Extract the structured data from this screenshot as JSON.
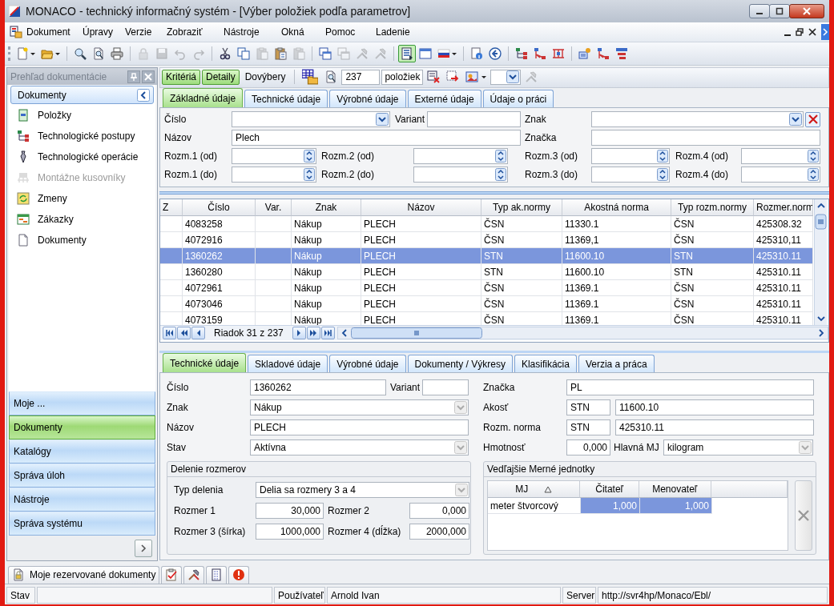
{
  "window": {
    "title": "MONACO - technický informačný systém - [Výber položiek podľa parametrov]"
  },
  "menu": [
    "Dokument",
    "Úpravy",
    "Verzie",
    "Zobraziť",
    "Nástroje",
    "Okná",
    "Pomoc",
    "Ladenie"
  ],
  "toolbar": [
    [
      {
        "kind": "new",
        "disabled": false,
        "pressed": false,
        "dropdown": true
      },
      {
        "kind": "open",
        "disabled": false,
        "pressed": false,
        "dropdown": true
      }
    ],
    [
      {
        "kind": "search",
        "disabled": false,
        "pressed": false,
        "dropdown": false
      },
      {
        "kind": "preview",
        "disabled": false,
        "pressed": false,
        "dropdown": false
      },
      {
        "kind": "print",
        "disabled": false,
        "pressed": false,
        "dropdown": false
      }
    ],
    [
      {
        "kind": "lock",
        "disabled": true,
        "pressed": false,
        "dropdown": false
      },
      {
        "kind": "save",
        "disabled": true,
        "pressed": false,
        "dropdown": false
      },
      {
        "kind": "undo",
        "disabled": true,
        "pressed": false,
        "dropdown": false
      },
      {
        "kind": "redo",
        "disabled": true,
        "pressed": false,
        "dropdown": false
      }
    ],
    [
      {
        "kind": "cut",
        "disabled": false,
        "pressed": false,
        "dropdown": false
      },
      {
        "kind": "copy",
        "disabled": false,
        "pressed": false,
        "dropdown": false
      },
      {
        "kind": "paste",
        "disabled": true,
        "pressed": false,
        "dropdown": false
      },
      {
        "kind": "paste_special",
        "disabled": false,
        "pressed": false,
        "dropdown": false
      },
      {
        "kind": "paste",
        "disabled": true,
        "pressed": false,
        "dropdown": false
      }
    ],
    [
      {
        "kind": "cascade",
        "disabled": false,
        "pressed": false,
        "dropdown": false
      },
      {
        "kind": "cascade",
        "disabled": true,
        "pressed": false,
        "dropdown": false
      },
      {
        "kind": "tools",
        "disabled": true,
        "pressed": false,
        "dropdown": false
      },
      {
        "kind": "tools",
        "disabled": true,
        "pressed": false,
        "dropdown": false
      }
    ],
    [
      {
        "kind": "view",
        "disabled": false,
        "pressed": true,
        "dropdown": false
      },
      {
        "kind": "window",
        "disabled": false,
        "pressed": false,
        "dropdown": false
      },
      {
        "kind": "flag",
        "disabled": false,
        "pressed": false,
        "dropdown": true
      }
    ],
    [
      {
        "kind": "info",
        "disabled": false,
        "pressed": false,
        "dropdown": false
      },
      {
        "kind": "back",
        "disabled": false,
        "pressed": false,
        "dropdown": false
      }
    ],
    [
      {
        "kind": "tree",
        "disabled": false,
        "pressed": false,
        "dropdown": false
      },
      {
        "kind": "tree_red",
        "disabled": false,
        "pressed": false,
        "dropdown": false
      },
      {
        "kind": "tree_net",
        "disabled": false,
        "pressed": false,
        "dropdown": false
      }
    ],
    [
      {
        "kind": "assign",
        "disabled": false,
        "pressed": false,
        "dropdown": false
      },
      {
        "kind": "tree_red",
        "disabled": false,
        "pressed": false,
        "dropdown": false
      },
      {
        "kind": "hierarchy",
        "disabled": false,
        "pressed": false,
        "dropdown": false
      }
    ]
  ],
  "sidebar": {
    "title": "Prehľad dokumentácie",
    "section": "Dokumenty",
    "items": [
      {
        "label": "Položky",
        "kind": "item",
        "disabled": false
      },
      {
        "label": "Technologické postupy",
        "kind": "route",
        "disabled": false
      },
      {
        "label": "Technologické operácie",
        "kind": "operation",
        "disabled": false
      },
      {
        "label": "Montážne kusovníky",
        "kind": "assembly",
        "disabled": true
      },
      {
        "label": "Zmeny",
        "kind": "change",
        "disabled": false
      },
      {
        "label": "Zákazky",
        "kind": "order",
        "disabled": false
      },
      {
        "label": "Dokumenty",
        "kind": "document",
        "disabled": false
      }
    ],
    "nav": [
      {
        "label": "Moje ...",
        "selected": false
      },
      {
        "label": "Dokumenty",
        "selected": true
      },
      {
        "label": "Katalógy",
        "selected": false
      },
      {
        "label": "Správa úloh",
        "selected": false
      },
      {
        "label": "Nástroje",
        "selected": false
      },
      {
        "label": "Správa systému",
        "selected": false
      }
    ]
  },
  "query_bar": {
    "buttons": [
      {
        "label": "Kritériá",
        "on": true
      },
      {
        "label": "Detaily",
        "on": true
      },
      {
        "label": "Dovýbery",
        "on": false
      }
    ],
    "tools": [
      {
        "kind": "table_folder",
        "disabled": false,
        "dropdown": false
      },
      {
        "kind": "preview",
        "disabled": false,
        "dropdown": false
      }
    ],
    "count": "237",
    "count_label": "položiek",
    "tools_after": [
      {
        "kind": "clear_filter",
        "disabled": false,
        "dropdown": false
      },
      {
        "kind": "export",
        "disabled": false,
        "dropdown": false
      },
      {
        "kind": "picture",
        "disabled": false,
        "dropdown": true
      },
      {
        "kind": "combo",
        "disabled": false,
        "dropdown": false
      },
      {
        "kind": "tools",
        "disabled": true,
        "dropdown": false
      }
    ]
  },
  "filter": {
    "tabs": [
      {
        "label": "Základné údaje",
        "selected": true
      },
      {
        "label": "Technické údaje",
        "selected": false
      },
      {
        "label": "Výrobné údaje",
        "selected": false
      },
      {
        "label": "Externé údaje",
        "selected": false
      },
      {
        "label": "Údaje o práci",
        "selected": false
      }
    ],
    "top_left": [
      [
        {
          "label": "Číslo",
          "kind": "combo"
        },
        {
          "label": "Variant",
          "kind": "text"
        }
      ],
      [
        {
          "label": "Názov",
          "kind": "text",
          "value": "Plech"
        }
      ]
    ],
    "top_right": [
      [
        {
          "label": "Znak",
          "kind": "combo_clear"
        }
      ],
      [
        {
          "label": "Značka",
          "kind": "text"
        }
      ]
    ],
    "ranges": [
      [
        {
          "label": "Rozm.1 (od)",
          "kind": "spin"
        },
        {
          "label": "Rozm.2 (od)",
          "kind": "spin"
        },
        {
          "label": "Rozm.3 (od)",
          "kind": "spin"
        },
        {
          "label": "Rozm.4 (od)",
          "kind": "spin"
        }
      ],
      [
        {
          "label": "Rozm.1 (do)",
          "kind": "spin"
        },
        {
          "label": "Rozm.2 (do)",
          "kind": "spin"
        },
        {
          "label": "Rozm.3 (do)",
          "kind": "spin"
        },
        {
          "label": "Rozm.4 (do)",
          "kind": "spin"
        }
      ]
    ]
  },
  "grid": {
    "columns": [
      "Z",
      "Číslo",
      "Var.",
      "Znak",
      "Názov",
      "Typ ak.normy",
      "Akostná norma",
      "Typ rozm.normy",
      "Rozmer.norm"
    ],
    "rows": [
      {
        "cislo": "4083258",
        "znak": "Nákup",
        "nazov": "PLECH",
        "typ_ak_normy": "ČSN",
        "akostna_norma": "11330.1",
        "typ_rozm_normy": "ČSN",
        "rozmer_normy": "425308.32",
        "selected": false
      },
      {
        "cislo": "4072916",
        "znak": "Nákup",
        "nazov": "PLECH",
        "typ_ak_normy": "ČSN",
        "akostna_norma": "11369,1",
        "typ_rozm_normy": "ČSN",
        "rozmer_normy": "425310,11",
        "selected": false
      },
      {
        "cislo": "1360262",
        "znak": "Nákup",
        "nazov": "PLECH",
        "typ_ak_normy": "STN",
        "akostna_norma": "11600.10",
        "typ_rozm_normy": "STN",
        "rozmer_normy": "425310.11",
        "selected": true
      },
      {
        "cislo": "1360280",
        "znak": "Nákup",
        "nazov": "PLECH",
        "typ_ak_normy": "STN",
        "akostna_norma": "11600.10",
        "typ_rozm_normy": "STN",
        "rozmer_normy": "425310.11",
        "selected": false
      },
      {
        "cislo": "4072961",
        "znak": "Nákup",
        "nazov": "PLECH",
        "typ_ak_normy": "ČSN",
        "akostna_norma": "11369.1",
        "typ_rozm_normy": "ČSN",
        "rozmer_normy": "425310.11",
        "selected": false
      },
      {
        "cislo": "4073046",
        "znak": "Nákup",
        "nazov": "PLECH",
        "typ_ak_normy": "ČSN",
        "akostna_norma": "11369.1",
        "typ_rozm_normy": "ČSN",
        "rozmer_normy": "425310.11",
        "selected": false
      },
      {
        "cislo": "4073159",
        "znak": "Nákup",
        "nazov": "PLECH",
        "typ_ak_normy": "ČSN",
        "akostna_norma": "11369.1",
        "typ_rozm_normy": "ČSN",
        "rozmer_normy": "425310.11",
        "selected": false
      }
    ],
    "navigator": "Riadok 31 z 237"
  },
  "detail": {
    "tabs": [
      {
        "label": "Technické údaje",
        "selected": true
      },
      {
        "label": "Skladové údaje",
        "selected": false
      },
      {
        "label": "Výrobné údaje",
        "selected": false
      },
      {
        "label": "Dokumenty / Výkresy",
        "selected": false
      },
      {
        "label": "Klasifikácia",
        "selected": false
      },
      {
        "label": "Verzia a práca",
        "selected": false
      }
    ],
    "left": [
      [
        {
          "label": "Číslo",
          "kind": "text",
          "value": "1360262"
        },
        {
          "label": "Variant",
          "kind": "text"
        }
      ],
      [
        {
          "label": "Znak",
          "kind": "select",
          "value": "Nákup"
        }
      ],
      [
        {
          "label": "Názov",
          "kind": "text",
          "value": "PLECH"
        }
      ],
      [
        {
          "label": "Stav",
          "kind": "select",
          "value": "Aktívna"
        }
      ]
    ],
    "right": [
      [
        {
          "label": "Značka",
          "kind": "text",
          "value": "PL"
        }
      ],
      [
        {
          "label": "Akosť",
          "kind": "text",
          "value": "STN"
        },
        {
          "kind": "text",
          "value": "11600.10"
        }
      ],
      [
        {
          "label": "Rozm. norma",
          "kind": "text",
          "value": "STN"
        },
        {
          "kind": "text",
          "value": "425310.11"
        }
      ],
      [
        {
          "label": "Hmotnosť",
          "kind": "number",
          "value": "0,000"
        },
        {
          "label": "Hlavná MJ",
          "kind": "select",
          "value": "kilogram"
        }
      ]
    ],
    "split": {
      "title": "Delenie rozmerov",
      "rows": [
        [
          {
            "label": "Typ delenia",
            "kind": "select",
            "value": "Delia sa rozmery 3 a 4"
          }
        ],
        [
          {
            "label": "Rozmer 1",
            "kind": "number",
            "value": "30,000"
          },
          {
            "label": "Rozmer 2",
            "kind": "number",
            "value": "0,000"
          }
        ],
        [
          {
            "label": "Rozmer 3 (šírka)",
            "kind": "number",
            "value": "1000,000"
          },
          {
            "label": "Rozmer 4 (dĺžka)",
            "kind": "number",
            "value": "2000,000"
          }
        ]
      ]
    },
    "units": {
      "title": "Vedľajšie Merné jednotky",
      "columns": [
        {
          "label": "MJ",
          "sorted": true
        },
        {
          "label": "Čitateľ",
          "sorted": false
        },
        {
          "label": "Menovateľ",
          "sorted": false
        }
      ],
      "rows": [
        {
          "cells": [
            "meter štvorcový",
            "1,000",
            "1,000"
          ],
          "selected": true
        }
      ]
    }
  },
  "bottom_tabs": [
    {
      "kind": "reserved",
      "label": "Moje rezervované dokumenty"
    },
    {
      "kind": "checklist"
    },
    {
      "kind": "tools"
    },
    {
      "kind": "list"
    },
    {
      "kind": "alert"
    }
  ],
  "status_bar": {
    "status_label": "Stav",
    "user_label": "Používateľ",
    "user": "Arnold Ivan",
    "server_label": "Server",
    "server": "http://svr4hp/Monaco/Ebl/"
  }
}
